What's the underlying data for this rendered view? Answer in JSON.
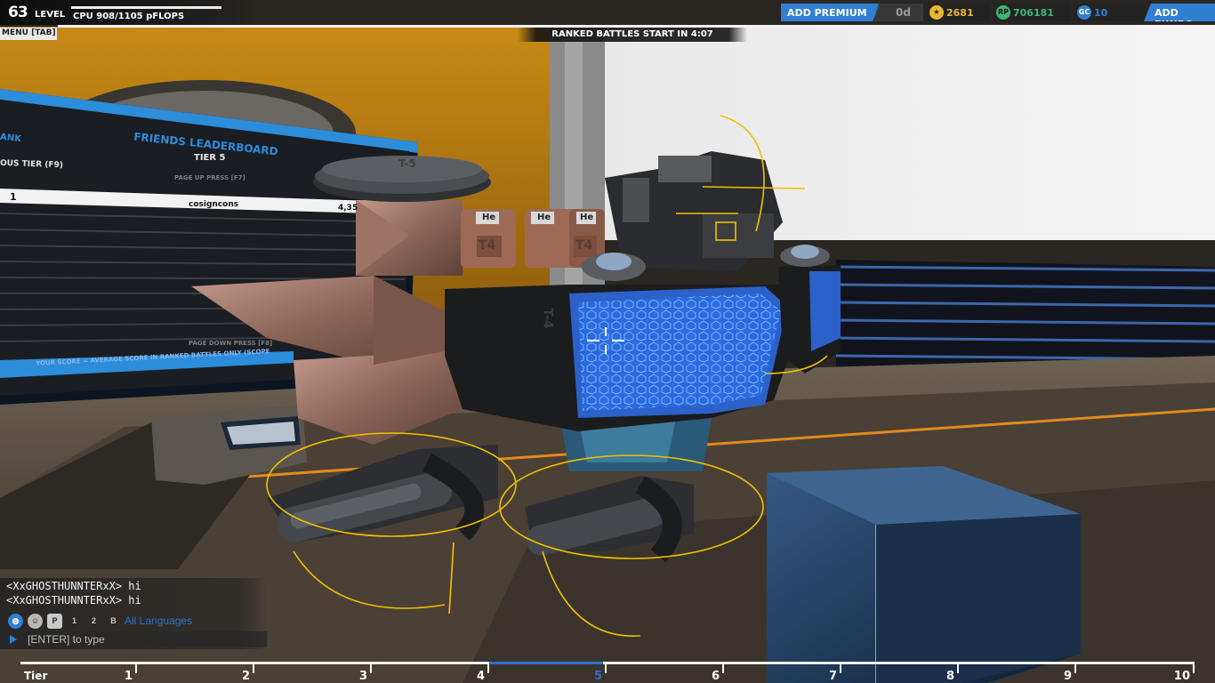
{
  "hud": {
    "level_number": "63",
    "level_word": "LEVEL",
    "cpu": "CPU 908/1105 pFLOPS",
    "cpu_usage_fraction": 0.82,
    "menu": "MENU [TAB]",
    "ranked_banner": "RANKED BATTLES START IN 4:07"
  },
  "currency": {
    "add_premium": "ADD PREMIUM",
    "premium_days": "0d",
    "stars": "2681",
    "robits": "706181",
    "galaxy_coins": "10",
    "add_funds": "ADD FUNDS",
    "icons": {
      "stars": "star-icon",
      "robits": "robits-icon",
      "galaxy_coins": "gc-icon"
    },
    "colors": {
      "accent": "#2f7fd2",
      "stars": "#e8b830",
      "robits": "#3fb872",
      "gc": "#2f7fd2"
    }
  },
  "leaderboard": {
    "title": "FRIENDS LEADERBOARD",
    "tier": "TIER 5",
    "rank_header": "ANK",
    "previous_tier": "OUS TIER (F9)",
    "page_up": "PAGE UP PRESS [F7]",
    "rank_value": "1",
    "player": "cosigncons",
    "score": "4,35",
    "page_down": "PAGE DOWN PRESS [F8]",
    "footer": "YOUR SCORE = AVERAGE SCORE IN RANKED BATTLES ONLY (SCOPE"
  },
  "robot": {
    "armor_label": "T-4",
    "tank_labels": [
      "T4",
      "T4"
    ],
    "tank_badges": [
      "He",
      "He",
      "He"
    ],
    "top_label": "T-5"
  },
  "chat": {
    "messages": [
      "<XxGHOSTHUNNTERxX> hi",
      "<XxGHOSTHUNNTERxX> hi"
    ],
    "channel_icons": [
      "globe-icon",
      "person-icon",
      "party-icon",
      "team-1-icon",
      "team-2-icon",
      "team-b-icon"
    ],
    "channel_icon_labels": [
      "",
      "",
      "P",
      "1",
      "2",
      "B"
    ],
    "language_filter": "All Languages",
    "input_placeholder": "[ENTER] to type"
  },
  "tiers": {
    "label": "Tier",
    "items": [
      "1",
      "2",
      "3",
      "4",
      "5",
      "6",
      "7",
      "8",
      "9",
      "10"
    ],
    "active": "5"
  }
}
